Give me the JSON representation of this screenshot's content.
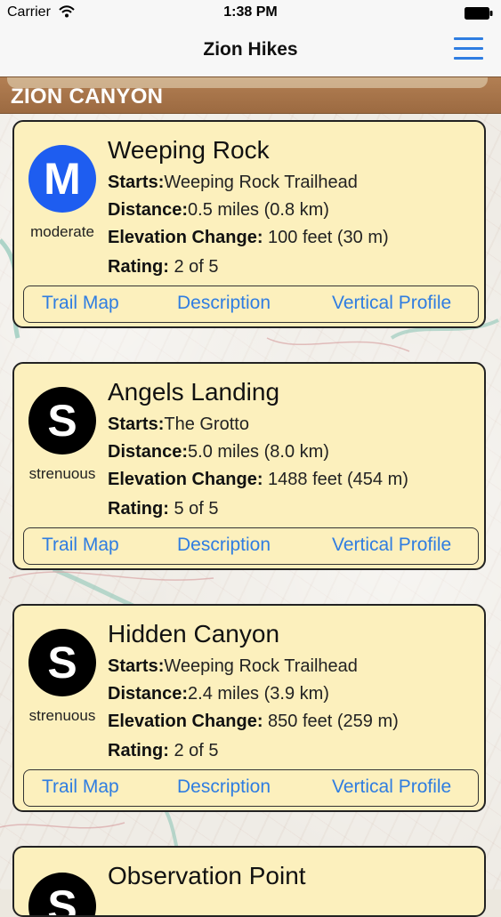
{
  "status_bar": {
    "carrier": "Carrier",
    "time": "1:38 PM"
  },
  "nav": {
    "title": "Zion Hikes"
  },
  "section": {
    "title": "ZION CANYON"
  },
  "labels": {
    "starts": "Starts:",
    "distance": "Distance:",
    "elevation": "Elevation Change:",
    "rating": "Rating:"
  },
  "actions": {
    "trail_map": "Trail Map",
    "description": "Description",
    "vertical_profile": "Vertical Profile"
  },
  "hikes": [
    {
      "name": "Weeping Rock",
      "badge_letter": "M",
      "difficulty": "moderate",
      "starts": "Weeping Rock Trailhead",
      "distance": "0.5 miles (0.8 km)",
      "elevation": "100 feet (30 m)",
      "rating": "2 of 5"
    },
    {
      "name": "Angels Landing",
      "badge_letter": "S",
      "difficulty": "strenuous",
      "starts": "The Grotto",
      "distance": "5.0 miles (8.0 km)",
      "elevation": "1488 feet (454 m)",
      "rating": "5 of 5"
    },
    {
      "name": "Hidden Canyon",
      "badge_letter": "S",
      "difficulty": "strenuous",
      "starts": "Weeping Rock Trailhead",
      "distance": "2.4 miles (3.9 km)",
      "elevation": "850 feet (259 m)",
      "rating": "2 of 5"
    },
    {
      "name": "Observation Point",
      "badge_letter": "S"
    }
  ],
  "colors": {
    "accent": "#2f7de1",
    "card_bg": "#fcf0bd",
    "section_header": "#a87548",
    "moderate_badge": "#1e5df0",
    "strenuous_badge": "#000000"
  }
}
